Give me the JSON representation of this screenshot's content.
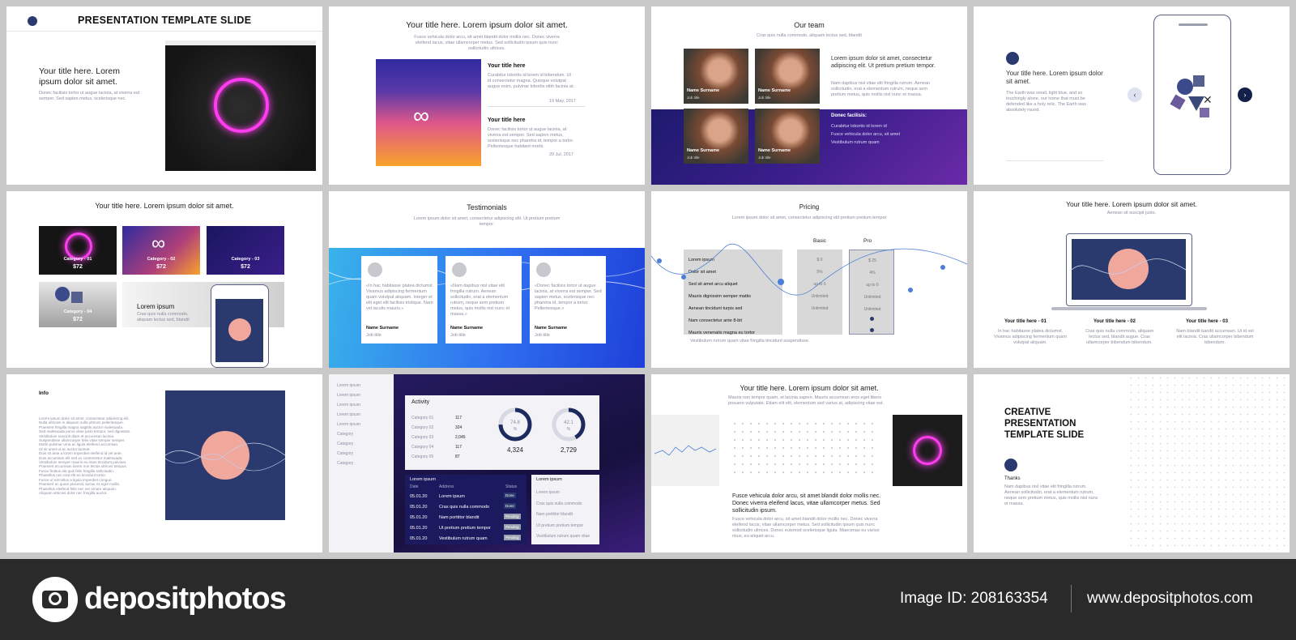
{
  "slide1": {
    "header": "PRESENTATION TEMPLATE SLIDE",
    "title": "Your title here. Lorem ipsum dolor sit amet.",
    "body": "Donec facilisis tortor ut augue lacinia, at viverra est semper. Sed sapien metus, scelerisque nec."
  },
  "slide2": {
    "title": "Your title here. Lorem ipsum dolor sit amet.",
    "subtitle": "Fusce vehicula dolor arcu, sit amet blandit dolor mollis nec. Donec viverra eleifend lacus, vitae ullamcorper metus. Sed sollicitudin ipsum quis nunc sollicitudin ultrices.",
    "items": [
      {
        "title": "Your title here",
        "body": "Curabitur lobortis id lorem id bibendum. Ut id consectetur magna. Quisque volutpat augue enim, pulvinar lobortis nibh lacinia at.",
        "date": "19 May, 2017"
      },
      {
        "title": "Your title here",
        "body": "Donec facilisis tortor ut augue lacinia, at viverra est semper. Sed sapien metus, scelerisque nec pharetra id, tempor a tortor. Pellentesque habitant morbi.",
        "date": "20 Jul, 2017"
      }
    ]
  },
  "slide3": {
    "title": "Our team",
    "subtitle": "Cras quis nulla commodo, aliquam lectus sed, blandit",
    "members": [
      {
        "name": "Name Surname",
        "role": "Job title"
      },
      {
        "name": "Name Surname",
        "role": "Job title"
      },
      {
        "name": "Name Surname",
        "role": "Job title"
      },
      {
        "name": "Name Surname",
        "role": "Job title"
      }
    ],
    "lead": "Lorem ipsum dolor sit amet, consectetur adipiscing elit. Ut pretium pretium tempor.",
    "lead_body": "Nam dapibus nisl vitae elit fringilla rutrum. Aenean sollicitudin, erat a elementum rutrum, neque sem pretium metus, quis mollis nisl nunc et massa.",
    "list_title": "Donec facilisis:",
    "list": [
      "Curabitur lobortis id lorem id",
      "Fusce vehicula dolor arcu, sit amet",
      "Vestibulum rutrum quam"
    ]
  },
  "slide4": {
    "title": "Your title here. Lorem ipsum dolor sit amet.",
    "body": "The Earth was small, light blue, and so touchingly alone, our home that must be defended like a holy relic. The Earth was absolutely round."
  },
  "slide5": {
    "title": "Your title here. Lorem ipsum dolor sit amet.",
    "categories": [
      {
        "label": "Category - 01",
        "price": "$72"
      },
      {
        "label": "Category - 02",
        "price": "$72"
      },
      {
        "label": "Category - 03",
        "price": "$72"
      },
      {
        "label": "Category - 04",
        "price": "$72"
      }
    ],
    "lorem_title": "Lorem ipsum",
    "lorem_body": "Cras quis nulla commodo, aliquam lectus sed, blandit"
  },
  "slide6": {
    "title": "Testimonials",
    "subtitle": "Lorem ipsum dolor sit amet, consectetur adipiscing elit. Ut pretium pretium tempor.",
    "cards": [
      {
        "quote": "«In hac habitasse platea dictumst. Vivamus adipiscing fermentum quam volutpat aliquam. Integer et elit eget elit facilisis tristique. Nam vel iaculis mauris.»",
        "name": "Name Surname",
        "role": "Job title"
      },
      {
        "quote": "«Nam dapibus nisl vitae elit fringilla rutrum. Aenean sollicitudin, erat a elementum rutrum, neque sem pretium metus, quis mollis nisl nunc et massa.»",
        "name": "Name Surname",
        "role": "Job title"
      },
      {
        "quote": "«Donec facilisis tortor ut augue lacinia, at viverra est semper. Sed sapien metus, scelerisque nec pharetra id, tempor a tortor. Pellentesque.»",
        "name": "Name Surname",
        "role": "Job title"
      }
    ]
  },
  "slide7": {
    "title": "Pricing",
    "subtitle": "Lorem ipsum dolor sit amet, consectetur adipiscing elit pretium pretium tempor",
    "plans": [
      "Basic",
      "Pro"
    ],
    "features": [
      "Lorem ipsum",
      "Dolor sit amet",
      "Sed sit amet arcu aliquet",
      "Mauris dignissim semper mattis",
      "Aenean tincidunt turpis sed",
      "Nam consectetur ante 8-bit",
      "Mauris venenatis magna eu tortor"
    ],
    "basic": [
      "$ 0",
      "5%",
      "up to 6",
      "Unlimited",
      "Unlimited",
      "",
      ""
    ],
    "pro": [
      "$ 25",
      "4%",
      "up to 6",
      "Unlimited",
      "Unlimited",
      "",
      ""
    ],
    "footnote": "Vestibulum rutrum quam vitae fringilla tincidunt suspendisse."
  },
  "slide8": {
    "title": "Your title here. Lorem ipsum dolor sit amet.",
    "subtitle": "Aenean sit suscipit justo.",
    "cols": [
      {
        "title": "Your title here - 01",
        "body": "In hac habitasse platea dictumst. Vivamus adipiscing fermentum quam volutpat aliquam."
      },
      {
        "title": "Your title here - 02",
        "body": "Cras quis nulla commodo, aliquam lectus sed, blandit augue. Cras ullamcorper bibendum bibendum."
      },
      {
        "title": "Your title here - 03",
        "body": "Nam blandit bandit accumsan. Ut id vel elit lacinia. Cras ullamcorper bibendum bibendum."
      }
    ]
  },
  "slide9": {
    "title": "Info",
    "lines": [
      "Lorem ipsum dolor sit amet, consectetur adipiscing elit.",
      "Nulla ultricies in aliquam nulla ultrices pellentesque.",
      "Praesent fringilla magna sagittis auctor malesuada.",
      "Sed malesuada purus vitae justo tempor, sed dignissim.",
      "Vestibulum suscipit diam et accumsan lacinia.",
      "Suspendisse ullamcorper felis vitae semper semper.",
      "Morbi pulvinar urna ac ligula eleifend accumsan.",
      "Ut sit amet ut ac auctor laoreet.",
      "Duis sit ante a lorem imperdiet eleifend id vel ante.",
      "Duis accumsan elit sed ex consectetur malesuada.",
      "Vestibulum semper mauris eu risus tincidunt pulvinar.",
      "Praesent accumsan lorem non lectus ultrices tempus.",
      "Fusce finibus elit quis felis fringilla sollicitudin.",
      "Phasellus non erat elit eu tincidunt tortor.",
      "Fusce ut est tellus a ligula imperdiet congue.",
      "Praesent ac quam placerat, luctus mi eget mollis.",
      "Phasellus eleifend felis nec est ornare aliquam.",
      "Aliquam ultricies dolor nec fringilla auctor."
    ]
  },
  "slide10": {
    "sidebar": [
      "Lorem ipsum",
      "Lorem ipsum",
      "Lorem ipsum",
      "Lorem ipsum",
      "Lorem ipsum",
      "Category",
      "Category",
      "Category",
      "Category"
    ],
    "activity_title": "Activity",
    "activity_rows": [
      {
        "label": "Category 01",
        "value": "117"
      },
      {
        "label": "Category 02",
        "value": "324"
      },
      {
        "label": "Category 03",
        "value": "2,045"
      },
      {
        "label": "Category 04",
        "value": "117"
      },
      {
        "label": "Category 05",
        "value": "87"
      }
    ],
    "donuts": [
      {
        "pct": "74.8",
        "unit": "%",
        "value": "4,324",
        "fraction": 0.748
      },
      {
        "pct": "42.1",
        "unit": "%",
        "value": "2,729",
        "fraction": 0.421
      }
    ],
    "table_title": "Lorem ipsum",
    "table_headers": [
      "Date",
      "Address",
      "Status"
    ],
    "table_rows": [
      {
        "date": "05.01.20",
        "address": "Lorem ipsum",
        "status": "Done"
      },
      {
        "date": "05.01.20",
        "address": "Cras quis nulla commodo",
        "status": "Done"
      },
      {
        "date": "05.01.20",
        "address": "Nam porttitor blandit",
        "status": "Pending"
      },
      {
        "date": "05.01.20",
        "address": "Ut pretium pretium tempor",
        "status": "Pending"
      },
      {
        "date": "05.01.20",
        "address": "Vestibulum rutrum quam",
        "status": "Pending"
      }
    ],
    "list_title": "Lorem ipsum",
    "list": [
      "Lorem ipsum",
      "Cras quis nulla commodo",
      "Nam porttitor blandit",
      "Ut pretium pretium tempor",
      "Vestibulum rutrum quam vitae"
    ]
  },
  "slide11": {
    "title": "Your title here. Lorem ipsum dolor sit amet.",
    "subtitle": "Mauris non tempor quam, et lacinia sapien. Mauris accumsan eros eget libero posuere vulputate. Etiam elit elit, elementum sed varius at, adipiscing vitae est.",
    "lead": "Fusce vehicula dolor arcu, sit amet blandit dolor mollis nec. Donec viverra eleifend lacus, vitae ullamcorper metus. Sed sollicitudin ipsum.",
    "body": "Fusce vehicula dolor arcu, sit amet blandit dolor mollis nec. Donec viverra eleifend lacus, vitae ullamcorper metus. Sed sollicitudin ipsum quis nunc sollicitudin ultrices. Donec euismod scelerisque ligula. Maecenas eu varius risus, eu aliquet arcu."
  },
  "slide12": {
    "title": "CREATIVE PRESENTATION TEMPLATE SLIDE",
    "thanks": "Thanks",
    "body": "Nam dapibus nisl vitae elit fringilla rutrum. Aenean sollicitudin, erat a elementum rutrum, neque sem pretium metus, quis mollis nisl nunc et massa."
  },
  "footer": {
    "brand": "depositphotos",
    "image_id": "Image ID: 208163354",
    "url": "www.depositphotos.com"
  },
  "colors": {
    "footer_bg": "#2a2a2a",
    "accent_pink": "#ff3cf0",
    "navy": "#2b3a6e",
    "coral": "#f0a79c",
    "blue_gradient": "#2f6ff0"
  }
}
